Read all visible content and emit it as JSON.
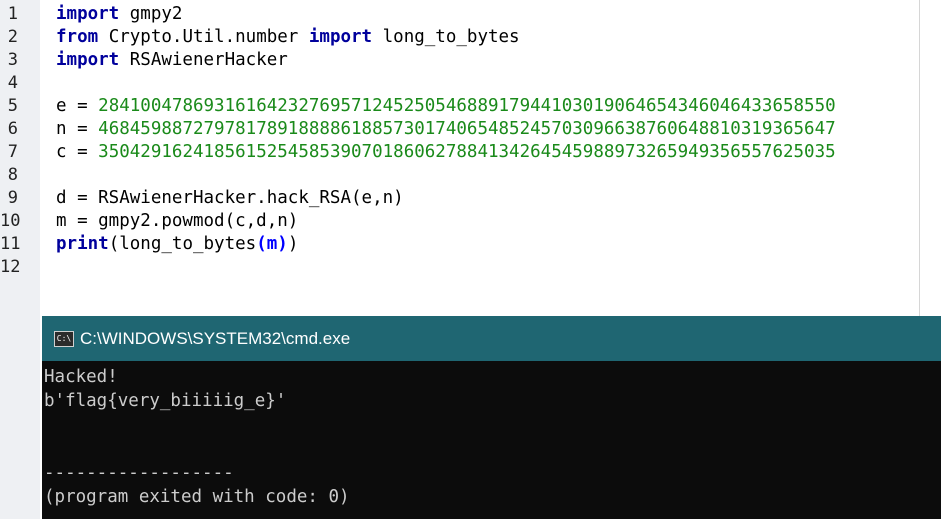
{
  "editor": {
    "line_numbers": [
      "1",
      "2",
      "3",
      "4",
      "5",
      "6",
      "7",
      "8",
      "9",
      "10",
      "11",
      "12"
    ],
    "lines": [
      [
        {
          "t": "kw",
          "v": "import"
        },
        {
          "t": "",
          "v": " gmpy2"
        }
      ],
      [
        {
          "t": "kw",
          "v": "from"
        },
        {
          "t": "",
          "v": " Crypto.Util.number "
        },
        {
          "t": "kw",
          "v": "import"
        },
        {
          "t": "",
          "v": " long_to_bytes"
        }
      ],
      [
        {
          "t": "kw",
          "v": "import"
        },
        {
          "t": "",
          "v": " RSAwienerHacker"
        }
      ],
      [],
      [
        {
          "t": "",
          "v": "e = "
        },
        {
          "t": "num",
          "v": "2841004786931616423276957124525054688917944103019064654346046433658550"
        }
      ],
      [
        {
          "t": "",
          "v": "n = "
        },
        {
          "t": "num",
          "v": "4684598872797817891888861885730174065485245703096638760648810319365647"
        }
      ],
      [
        {
          "t": "",
          "v": "c = "
        },
        {
          "t": "num",
          "v": "3504291624185615254585390701860627884134264545988973265949356557625035"
        }
      ],
      [],
      [
        {
          "t": "",
          "v": "d = RSAwienerHacker.hack_RSA(e,n)"
        }
      ],
      [
        {
          "t": "",
          "v": "m = gmpy2.powmod(c,d,n)"
        }
      ],
      [
        {
          "t": "kw",
          "v": "print"
        },
        {
          "t": "",
          "v": "(long_to_bytes"
        },
        {
          "t": "paren",
          "v": "(m)"
        },
        {
          "t": "",
          "v": ")"
        }
      ],
      []
    ]
  },
  "console": {
    "title": "C:\\WINDOWS\\SYSTEM32\\cmd.exe",
    "icon": "cmd-window-icon",
    "icon_text": "C:\\",
    "lines": [
      "Hacked!",
      "b'flag{very_biiiiig_e}'",
      "",
      "",
      "------------------",
      "(program exited with code: 0)"
    ]
  }
}
